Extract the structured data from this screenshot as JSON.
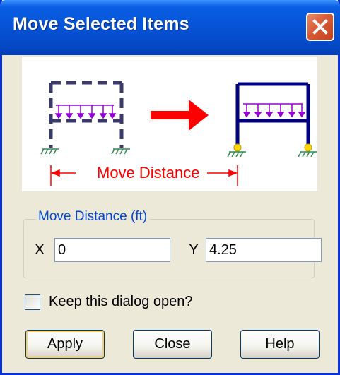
{
  "window": {
    "title": "Move Selected Items"
  },
  "illustration": {
    "distance_label": "Move Distance"
  },
  "move_distance": {
    "group_label": "Move Distance (ft)",
    "x_label": "X",
    "x_value": "0",
    "y_label": "Y",
    "y_value": "4.25"
  },
  "options": {
    "keep_open_label": "Keep this dialog open?",
    "keep_open_checked": false
  },
  "buttons": {
    "apply": "Apply",
    "close": "Close",
    "help": "Help"
  },
  "colors": {
    "titlebar": "#0653d6",
    "frame": "#000080",
    "load": "#9400d3",
    "arrow": "#ff0000",
    "support": "#ffd700",
    "group_title": "#0046d5"
  },
  "icons": [
    "close-icon",
    "fixed-support-icon",
    "arrow-right-icon"
  ]
}
